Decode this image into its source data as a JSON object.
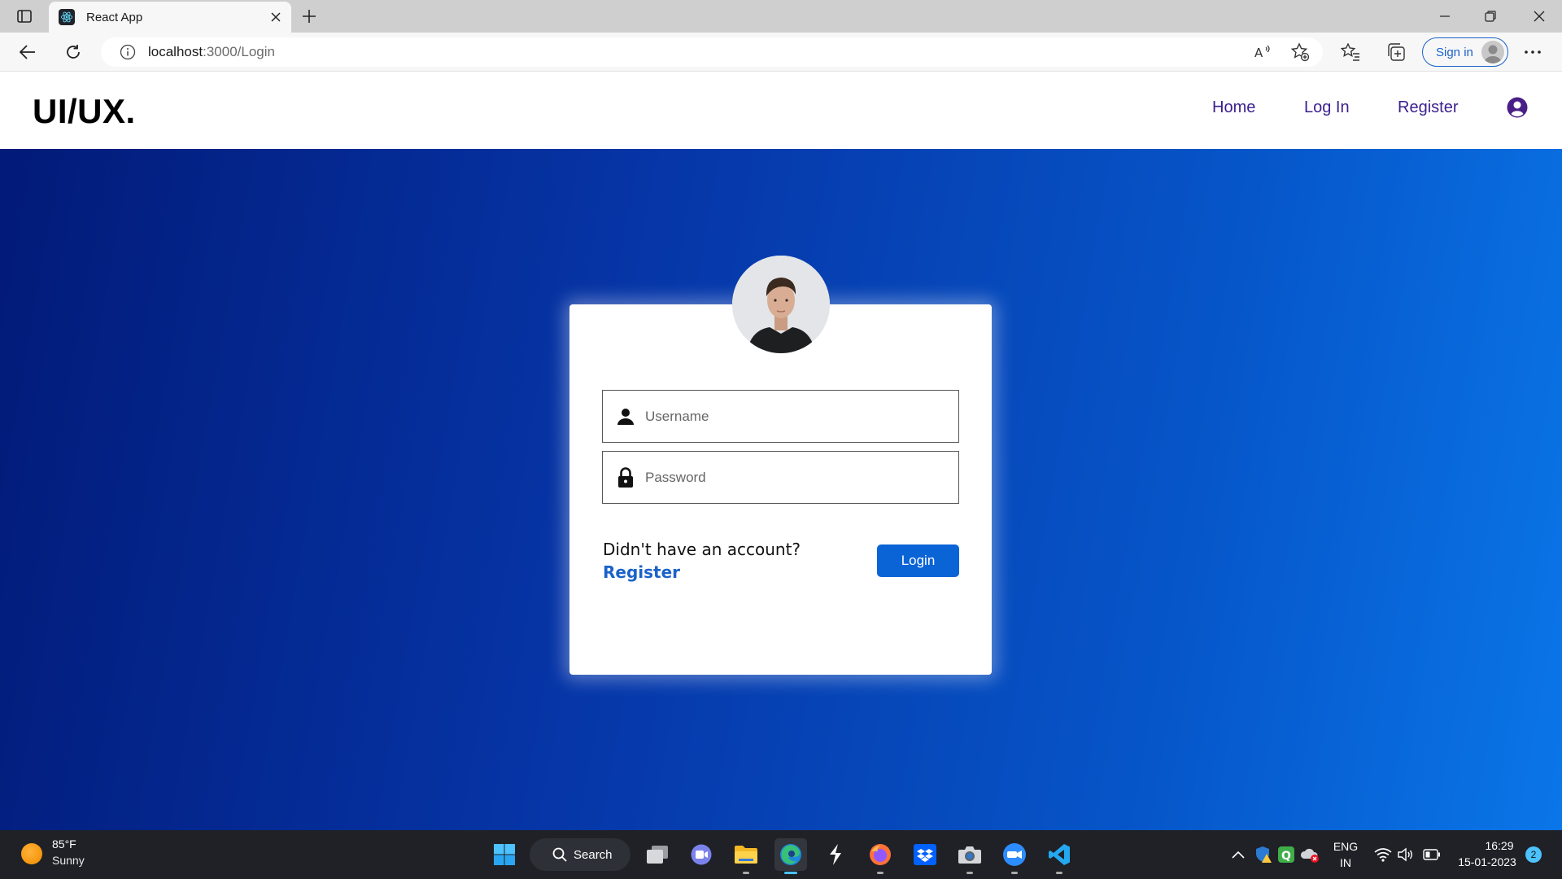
{
  "browser": {
    "tab_title": "React App",
    "url_host": "localhost",
    "url_path": ":3000/Login",
    "signin_label": "Sign in"
  },
  "page": {
    "brand": "UI/UX.",
    "nav": {
      "home": "Home",
      "login": "Log In",
      "register": "Register"
    }
  },
  "login_form": {
    "username_placeholder": "Username",
    "password_placeholder": "Password",
    "no_account_text": "Didn't have an account?",
    "register_link": "Register",
    "login_button": "Login"
  },
  "taskbar": {
    "weather_temp": "85°F",
    "weather_condition": "Sunny",
    "search_label": "Search",
    "lang_primary": "ENG",
    "lang_secondary": "IN",
    "time": "16:29",
    "date": "15-01-2023",
    "notification_count": "2"
  },
  "colors": {
    "hero_gradient_start": "#021a78",
    "hero_gradient_end": "#0a76e8",
    "nav_link": "#3b1f8e",
    "login_button": "#0a64d6",
    "register_link": "#1a62c9"
  }
}
